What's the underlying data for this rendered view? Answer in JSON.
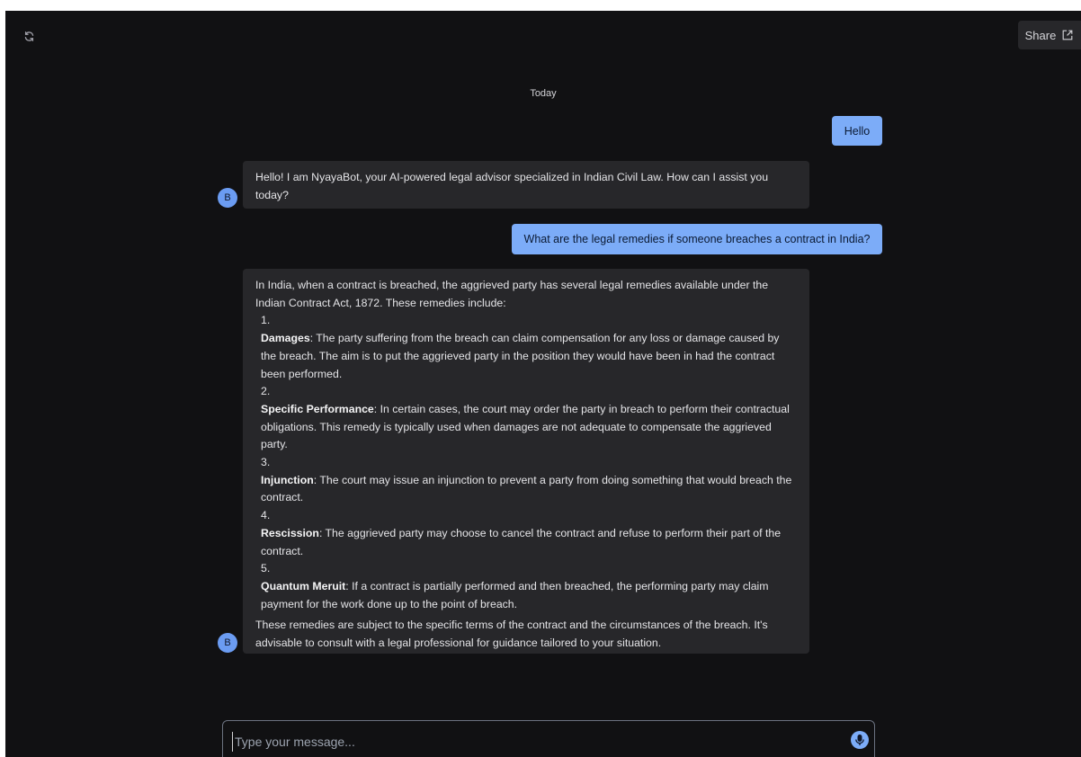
{
  "header": {
    "refresh_icon": "refresh-icon",
    "share_label": "Share",
    "share_icon": "external-link-icon"
  },
  "date_separator": "Today",
  "messages": [
    {
      "role": "user",
      "text": "Hello"
    },
    {
      "role": "bot",
      "avatar": "B",
      "text": "Hello! I am NyayaBot, your AI-powered legal advisor specialized in Indian Civil Law. How can I assist you today?"
    },
    {
      "role": "user",
      "text": "What are the legal remedies if someone breaches a contract in India?"
    },
    {
      "role": "bot",
      "avatar": "B",
      "intro": "In India, when a contract is breached, the aggrieved party has several legal remedies available under the Indian Contract Act, 1872. These remedies include:",
      "items": [
        {
          "num": "1.",
          "title": "Damages",
          "text": ": The party suffering from the breach can claim compensation for any loss or damage caused by the breach. The aim is to put the aggrieved party in the position they would have been in had the contract been performed."
        },
        {
          "num": "2.",
          "title": "Specific Performance",
          "text": ": In certain cases, the court may order the party in breach to perform their contractual obligations. This remedy is typically used when damages are not adequate to compensate the aggrieved party."
        },
        {
          "num": "3.",
          "title": "Injunction",
          "text": ": The court may issue an injunction to prevent a party from doing something that would breach the contract."
        },
        {
          "num": "4.",
          "title": "Rescission",
          "text": ": The aggrieved party may choose to cancel the contract and refuse to perform their part of the contract."
        },
        {
          "num": "5.",
          "title": "Quantum Meruit",
          "text": ": If a contract is partially performed and then breached, the performing party may claim payment for the work done up to the point of breach."
        }
      ],
      "closing": "These remedies are subject to the specific terms of the contract and the circumstances of the breach. It's advisable to consult with a legal professional for guidance tailored to your situation."
    }
  ],
  "composer": {
    "placeholder": "Type your message...",
    "value": "",
    "mic_icon": "microphone-icon"
  },
  "colors": {
    "background": "#111113",
    "bubble_bot": "#27272a",
    "bubble_user": "#7cacf8",
    "avatar": "#6b9cf2"
  }
}
